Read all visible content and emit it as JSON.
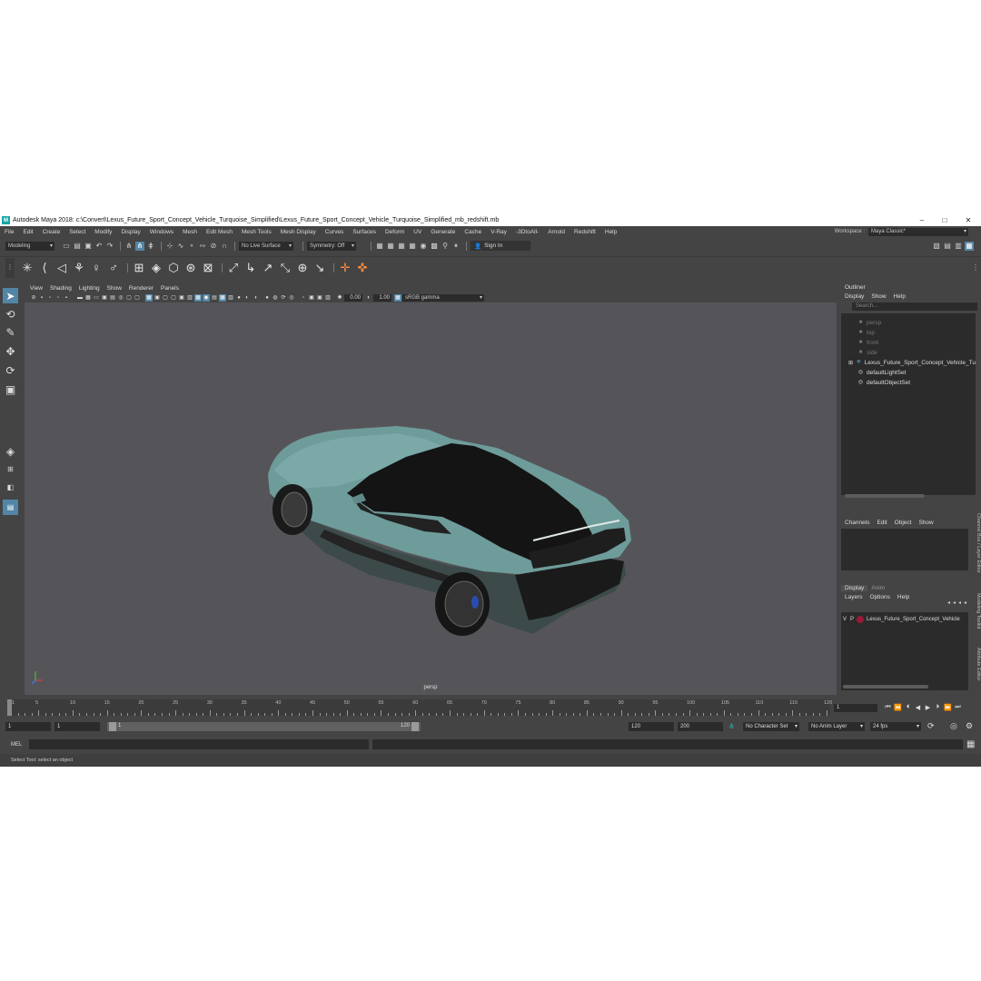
{
  "window": {
    "title": "Autodesk Maya 2018: c:\\Convert\\Lexus_Future_Sport_Concept_Vehicle_Turquoise_Simplified\\Lexus_Future_Sport_Concept_Vehicle_Turquoise_Simplified_mb_redshift.mb",
    "minimize": "–",
    "maximize": "□",
    "close": "✕"
  },
  "menubar": {
    "items": [
      "File",
      "Edit",
      "Create",
      "Select",
      "Modify",
      "Display",
      "Windows",
      "Mesh",
      "Edit Mesh",
      "Mesh Tools",
      "Mesh Display",
      "Curves",
      "Surfaces",
      "Deform",
      "UV",
      "Generate",
      "Cache",
      "V-Ray",
      "-3DtoAll-",
      "Arnold",
      "Redshift",
      "Help"
    ]
  },
  "workspace": {
    "label": "Workspace :",
    "value": "Maya Classic*"
  },
  "statusline": {
    "mode": "Modeling",
    "live_surface": "No Live Surface",
    "symmetry": "Symmetry: Off",
    "signin": "Sign In"
  },
  "viewport": {
    "menus": [
      "View",
      "Shading",
      "Lighting",
      "Show",
      "Renderer",
      "Panels"
    ],
    "exposure": "0.00",
    "gamma": "1.00",
    "color_space": "sRGB gamma",
    "camera_label": "persp",
    "body_color": "#6e9c9a",
    "background": "#555559"
  },
  "outliner": {
    "title": "Outliner",
    "menus": [
      "Display",
      "Show",
      "Help"
    ],
    "search_placeholder": "Search...",
    "items": [
      {
        "label": "persp",
        "icon": "camera-icon",
        "dim": true
      },
      {
        "label": "top",
        "icon": "camera-icon",
        "dim": true
      },
      {
        "label": "front",
        "icon": "camera-icon",
        "dim": true
      },
      {
        "label": "side",
        "icon": "camera-icon",
        "dim": true
      },
      {
        "label": "Lexus_Future_Sport_Concept_Vehicle_Tu",
        "icon": "group-icon",
        "dim": false
      },
      {
        "label": "defaultLightSet",
        "icon": "set-icon",
        "dim": false
      },
      {
        "label": "defaultObjectSet",
        "icon": "set-icon",
        "dim": false
      }
    ]
  },
  "channelbox": {
    "menus": [
      "Channels",
      "Edit",
      "Object",
      "Show"
    ]
  },
  "layereditor": {
    "tabs": [
      "Display",
      "Anim"
    ],
    "menus": [
      "Layers",
      "Options",
      "Help"
    ],
    "layer": {
      "v": "V",
      "p": "P",
      "name": "Lexus_Future_Sport_Concept_Vehicle",
      "color": "#9a1a38"
    }
  },
  "side_tabs": [
    "Channel Box / Layer Editor",
    "Modeling Toolkit",
    "Attribute Editor"
  ],
  "timeslider": {
    "ticks": [
      "5",
      "10",
      "15",
      "20",
      "25",
      "30",
      "35",
      "40",
      "45",
      "50",
      "55",
      "60",
      "65",
      "70",
      "75",
      "80",
      "85",
      "90",
      "95",
      "100",
      "105",
      "110",
      "115",
      "120"
    ],
    "first": "1",
    "current_frame": "1"
  },
  "range": {
    "start": "1",
    "playback_start": "1",
    "range_start": "1",
    "range_end": "120",
    "playback_end": "120",
    "end": "200",
    "character_set": "No Character Set",
    "anim_layer": "No Anim Layer",
    "fps": "24 fps"
  },
  "commandline": {
    "language": "MEL"
  },
  "helpline": {
    "text": "Select Tool: select an object"
  }
}
